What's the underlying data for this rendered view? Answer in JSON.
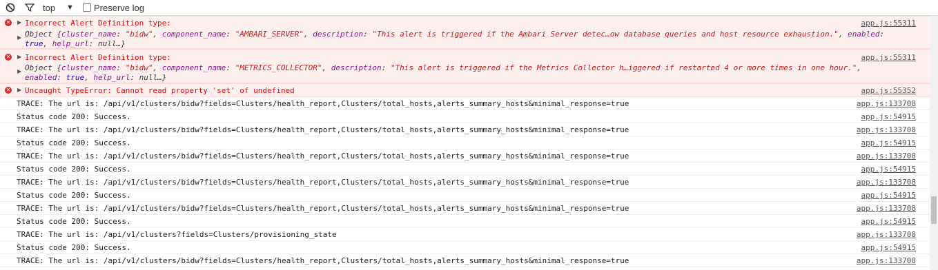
{
  "toolbar": {
    "context": "top",
    "context_arrow": "▼",
    "preserve_log_label": "Preserve log",
    "clear_icon": "⊘",
    "filter_icon": "⏚"
  },
  "errors": [
    {
      "title": "Incorrect Alert Definition type:",
      "source": "app.js:55311",
      "obj_parts": [
        {
          "t": "plain",
          "v": "Object {"
        },
        {
          "t": "prop",
          "v": "cluster_name"
        },
        {
          "t": "plain",
          "v": ": "
        },
        {
          "t": "str",
          "v": "\"bidw\""
        },
        {
          "t": "plain",
          "v": ", "
        },
        {
          "t": "prop",
          "v": "component_name"
        },
        {
          "t": "plain",
          "v": ": "
        },
        {
          "t": "str",
          "v": "\"AMBARI_SERVER\""
        },
        {
          "t": "plain",
          "v": ", "
        },
        {
          "t": "prop",
          "v": "description"
        },
        {
          "t": "plain",
          "v": ": "
        },
        {
          "t": "str",
          "v": "\"This alert is triggered if the Ambari Server detec…ow database queries and host resource exhaustion.\""
        },
        {
          "t": "plain",
          "v": ", "
        },
        {
          "t": "prop",
          "v": "enabled"
        },
        {
          "t": "plain",
          "v": ": "
        },
        {
          "t": "num",
          "v": "true"
        },
        {
          "t": "plain",
          "v": ", "
        },
        {
          "t": "prop",
          "v": "help_url"
        },
        {
          "t": "plain",
          "v": ": null…}"
        }
      ]
    },
    {
      "title": "Incorrect Alert Definition type:",
      "source": "app.js:55311",
      "obj_parts": [
        {
          "t": "plain",
          "v": "Object {"
        },
        {
          "t": "prop",
          "v": "cluster_name"
        },
        {
          "t": "plain",
          "v": ": "
        },
        {
          "t": "str",
          "v": "\"bidw\""
        },
        {
          "t": "plain",
          "v": ", "
        },
        {
          "t": "prop",
          "v": "component_name"
        },
        {
          "t": "plain",
          "v": ": "
        },
        {
          "t": "str",
          "v": "\"METRICS_COLLECTOR\""
        },
        {
          "t": "plain",
          "v": ", "
        },
        {
          "t": "prop",
          "v": "description"
        },
        {
          "t": "plain",
          "v": ": "
        },
        {
          "t": "str",
          "v": "\"This alert is triggered if the Metrics Collector h…iggered if restarted 4 or more times in one hour.\""
        },
        {
          "t": "plain",
          "v": ", "
        },
        {
          "t": "prop",
          "v": "enabled"
        },
        {
          "t": "plain",
          "v": ": "
        },
        {
          "t": "num",
          "v": "true"
        },
        {
          "t": "plain",
          "v": ", "
        },
        {
          "t": "prop",
          "v": "help_url"
        },
        {
          "t": "plain",
          "v": ": null…}"
        }
      ]
    },
    {
      "title": "Uncaught TypeError: Cannot read property 'set' of undefined",
      "source": "app.js:55352"
    }
  ],
  "logs": [
    {
      "text": "TRACE: The url is: /api/v1/clusters/bidw?fields=Clusters/health_report,Clusters/total_hosts,alerts_summary_hosts&minimal_response=true",
      "source": "app.js:133708"
    },
    {
      "text": "Status code 200: Success.",
      "source": "app.js:54915"
    },
    {
      "text": "TRACE: The url is: /api/v1/clusters/bidw?fields=Clusters/health_report,Clusters/total_hosts,alerts_summary_hosts&minimal_response=true",
      "source": "app.js:133708"
    },
    {
      "text": "Status code 200: Success.",
      "source": "app.js:54915"
    },
    {
      "text": "TRACE: The url is: /api/v1/clusters/bidw?fields=Clusters/health_report,Clusters/total_hosts,alerts_summary_hosts&minimal_response=true",
      "source": "app.js:133708"
    },
    {
      "text": "Status code 200: Success.",
      "source": "app.js:54915"
    },
    {
      "text": "TRACE: The url is: /api/v1/clusters/bidw?fields=Clusters/health_report,Clusters/total_hosts,alerts_summary_hosts&minimal_response=true",
      "source": "app.js:133708"
    },
    {
      "text": "Status code 200: Success.",
      "source": "app.js:54915"
    },
    {
      "text": "TRACE: The url is: /api/v1/clusters/bidw?fields=Clusters/health_report,Clusters/total_hosts,alerts_summary_hosts&minimal_response=true",
      "source": "app.js:133708"
    },
    {
      "text": "Status code 200: Success.",
      "source": "app.js:54915"
    },
    {
      "text": "TRACE: The url is: /api/v1/clusters?fields=Clusters/provisioning_state",
      "source": "app.js:133708"
    },
    {
      "text": "Status code 200: Success.",
      "source": "app.js:54915"
    },
    {
      "text": "TRACE: The url is: /api/v1/clusters/bidw?fields=Clusters/health_report,Clusters/total_hosts,alerts_summary_hosts&minimal_response=true",
      "source": "app.js:133708"
    }
  ]
}
